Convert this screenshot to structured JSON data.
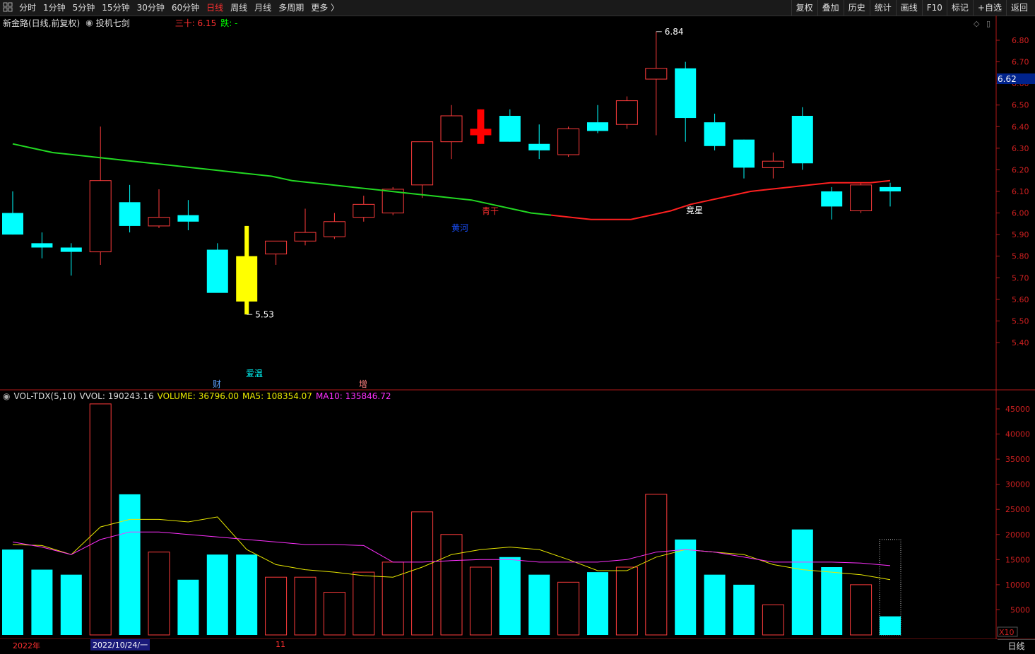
{
  "toolbar": {
    "left": [
      "分时",
      "1分钟",
      "5分钟",
      "15分钟",
      "30分钟",
      "60分钟",
      "日线",
      "周线",
      "月线",
      "多周期",
      "更多 〉"
    ],
    "active": "日线",
    "right": [
      "复权",
      "叠加",
      "历史",
      "统计",
      "画线",
      "F10",
      "标记",
      "+自选",
      "返回"
    ]
  },
  "header": {
    "title": "新金路(日线,前复权)",
    "indicator": "投机七剑",
    "thirty": "三十: 6.15",
    "fall": "跌: -"
  },
  "price_axis": {
    "labels": [
      "6.80",
      "6.70",
      "6.60",
      "6.50",
      "6.40",
      "6.30",
      "6.20",
      "6.10",
      "6.00",
      "5.90",
      "5.80",
      "5.70",
      "5.60",
      "5.50",
      "5.40"
    ],
    "current": "6.62"
  },
  "volume_axis": {
    "labels": [
      "45000",
      "40000",
      "35000",
      "30000",
      "25000",
      "20000",
      "15000",
      "10000",
      "5000"
    ],
    "unit": "X10"
  },
  "annotations": {
    "high": "6.84",
    "low": "5.53",
    "tag_cai": "财",
    "tag_ai": "爱温",
    "tag_zeng": "增",
    "tag_blue": "黄河",
    "tag_red": "青干",
    "tag_white": "竞星"
  },
  "volume_header": {
    "name": "VOL-TDX(5,10)",
    "vvol": "VVOL: 190243.16",
    "volume": "VOLUME: 36796.00",
    "ma5": "MA5: 108354.07",
    "ma10": "MA10: 135846.72"
  },
  "dates": {
    "year": "2022年",
    "cursor": "2022/10/24/一",
    "month": "11",
    "period": "日线"
  },
  "colors": {
    "up": "#ff3c3c",
    "down": "#00ffff",
    "axis": "#b01818",
    "ma_green": "#22d822",
    "ma_red": "#ff2020",
    "ma5": "#e8e800",
    "ma10": "#ff30ff",
    "highlight_yellow": "#ffff00",
    "highlight_red": "#ff0000"
  },
  "chart_data": {
    "type": "candlestick",
    "price_range": [
      5.3,
      6.88
    ],
    "volume_range": [
      0,
      47000
    ],
    "candles": [
      {
        "o": 6.0,
        "h": 6.1,
        "l": 5.9,
        "c": 5.9
      },
      {
        "o": 5.86,
        "h": 5.91,
        "l": 5.79,
        "c": 5.84
      },
      {
        "o": 5.84,
        "h": 5.86,
        "l": 5.71,
        "c": 5.82
      },
      {
        "o": 5.82,
        "h": 6.4,
        "l": 5.76,
        "c": 6.15
      },
      {
        "o": 6.05,
        "h": 6.13,
        "l": 5.91,
        "c": 5.94
      },
      {
        "o": 5.94,
        "h": 6.11,
        "l": 5.93,
        "c": 5.98
      },
      {
        "o": 5.99,
        "h": 6.06,
        "l": 5.92,
        "c": 5.96
      },
      {
        "o": 5.83,
        "h": 5.86,
        "l": 5.64,
        "c": 5.63
      },
      {
        "o": 5.8,
        "h": 5.94,
        "l": 5.53,
        "c": 5.59,
        "mark": "yellow"
      },
      {
        "o": 5.81,
        "h": 5.87,
        "l": 5.76,
        "c": 5.87
      },
      {
        "o": 5.87,
        "h": 6.02,
        "l": 5.85,
        "c": 5.91
      },
      {
        "o": 5.89,
        "h": 6.0,
        "l": 5.88,
        "c": 5.96
      },
      {
        "o": 5.98,
        "h": 6.08,
        "l": 5.96,
        "c": 6.04
      },
      {
        "o": 6.0,
        "h": 6.12,
        "l": 5.99,
        "c": 6.11
      },
      {
        "o": 6.13,
        "h": 6.27,
        "l": 6.07,
        "c": 6.33
      },
      {
        "o": 6.33,
        "h": 6.5,
        "l": 6.25,
        "c": 6.45
      },
      {
        "o": 6.36,
        "h": 6.48,
        "l": 6.32,
        "c": 6.39,
        "mark": "red"
      },
      {
        "o": 6.45,
        "h": 6.48,
        "l": 6.33,
        "c": 6.33
      },
      {
        "o": 6.32,
        "h": 6.41,
        "l": 6.25,
        "c": 6.29
      },
      {
        "o": 6.27,
        "h": 6.4,
        "l": 6.26,
        "c": 6.39
      },
      {
        "o": 6.42,
        "h": 6.5,
        "l": 6.37,
        "c": 6.38
      },
      {
        "o": 6.41,
        "h": 6.54,
        "l": 6.39,
        "c": 6.52
      },
      {
        "o": 6.62,
        "h": 6.84,
        "l": 6.36,
        "c": 6.67
      },
      {
        "o": 6.67,
        "h": 6.7,
        "l": 6.33,
        "c": 6.44
      },
      {
        "o": 6.42,
        "h": 6.46,
        "l": 6.29,
        "c": 6.31
      },
      {
        "o": 6.34,
        "h": 6.34,
        "l": 6.16,
        "c": 6.21
      },
      {
        "o": 6.21,
        "h": 6.28,
        "l": 6.16,
        "c": 6.24
      },
      {
        "o": 6.45,
        "h": 6.49,
        "l": 6.2,
        "c": 6.23
      },
      {
        "o": 6.1,
        "h": 6.12,
        "l": 5.97,
        "c": 6.03
      },
      {
        "o": 6.01,
        "h": 6.14,
        "l": 6.0,
        "c": 6.13
      },
      {
        "o": 6.12,
        "h": 6.14,
        "l": 6.03,
        "c": 6.1
      }
    ],
    "ma30": [
      6.32,
      6.3,
      6.28,
      6.27,
      6.26,
      6.25,
      6.24,
      6.23,
      6.22,
      6.21,
      6.2,
      6.19,
      6.18,
      6.17,
      6.15,
      6.14,
      6.13,
      6.12,
      6.11,
      6.1,
      6.09,
      6.08,
      6.07,
      6.06,
      6.04,
      6.02,
      6.0,
      5.99,
      5.98,
      5.97,
      5.97,
      5.97,
      5.99,
      6.01,
      6.04,
      6.06,
      6.08,
      6.1,
      6.11,
      6.12,
      6.13,
      6.14,
      6.14,
      6.14,
      6.15
    ],
    "volumes": [
      17000,
      13000,
      12000,
      46000,
      28000,
      16500,
      11000,
      16000,
      16000,
      11500,
      11500,
      8500,
      12500,
      14500,
      24500,
      20000,
      13500,
      15500,
      12000,
      10500,
      12500,
      13500,
      28000,
      19000,
      12000,
      10000,
      6000,
      21000,
      13500,
      10000,
      3700
    ],
    "ma5": [
      18000,
      17800,
      16000,
      21500,
      23000,
      23000,
      22500,
      23500,
      17000,
      14000,
      13000,
      12500,
      11800,
      11500,
      13500,
      16000,
      17000,
      17500,
      17000,
      15000,
      12800,
      12800,
      15500,
      17000,
      16500,
      16000,
      14000,
      13000,
      12500,
      12000,
      11000
    ],
    "ma10": [
      18500,
      17500,
      16000,
      19000,
      20500,
      20500,
      20000,
      19500,
      19000,
      18500,
      18000,
      18000,
      17800,
      14500,
      14500,
      14800,
      15000,
      15000,
      14500,
      14500,
      14500,
      15000,
      16500,
      17000,
      16500,
      15500,
      14500,
      14500,
      14500,
      14300,
      13800
    ]
  }
}
